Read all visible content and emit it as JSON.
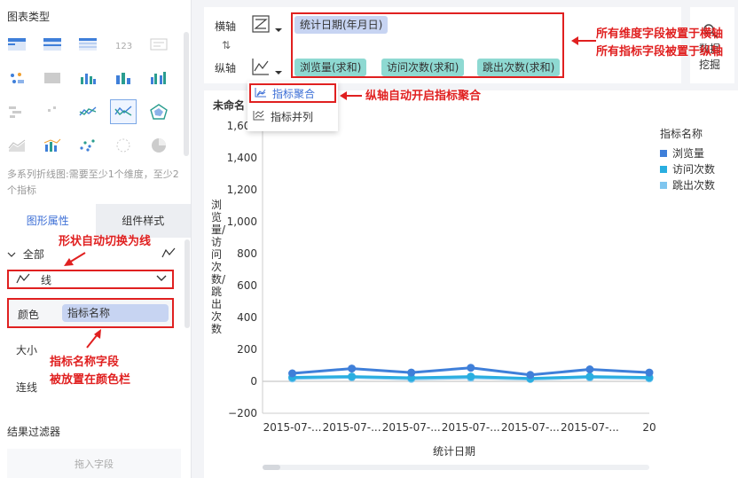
{
  "left_panel": {
    "title": "图表类型",
    "description": "多系列折线图:需要至少1个维度，至少2个指标",
    "chart_types": [
      {
        "icon": "grouped-table-icon"
      },
      {
        "icon": "cross-table-icon"
      },
      {
        "icon": "detail-table-icon"
      },
      {
        "icon": "kpi-card-icon"
      },
      {
        "icon": "text-card-icon"
      },
      {
        "icon": "scatter-map-icon"
      },
      {
        "icon": "heat-map-icon"
      },
      {
        "icon": "stacked-bar-icon"
      },
      {
        "icon": "bar-chart-icon"
      },
      {
        "icon": "grouped-bar-icon"
      },
      {
        "icon": "gantt-icon"
      },
      {
        "icon": "matrix-icon"
      },
      {
        "icon": "line-chart-icon"
      },
      {
        "icon": "multi-line-chart-icon",
        "selected": true
      },
      {
        "icon": "radar-icon"
      },
      {
        "icon": "area-chart-icon"
      },
      {
        "icon": "combo-chart-icon"
      },
      {
        "icon": "scatter-chart-icon"
      },
      {
        "icon": "bubble-chart-icon"
      },
      {
        "icon": "pie-chart-icon"
      }
    ],
    "tabs": [
      {
        "label": "图形属性",
        "active": true
      },
      {
        "label": "组件样式",
        "active": false
      }
    ],
    "all_label": "全部",
    "shape_value": "线",
    "color_label": "颜色",
    "color_field": "指标名称",
    "size_label": "大小",
    "connect_label": "连线",
    "filter_title": "结果过滤器",
    "drop_placeholder": "拖入字段"
  },
  "axis": {
    "x_label": "横轴",
    "y_label": "纵轴",
    "x_fields": [
      "统计日期(年月日)"
    ],
    "y_fields": [
      "浏览量(求和)",
      "访问次数(求和)",
      "跳出次数(求和)"
    ],
    "swap_glyph": "⇅"
  },
  "side_panel": {
    "line1": "数据",
    "line2": "挖掘"
  },
  "popup": {
    "items": [
      "指标聚合",
      "指标并列"
    ]
  },
  "annotations": {
    "top_right_1": "所有维度字段被置于横轴",
    "top_right_2": "所有指标字段被置于纵轴",
    "popup_note": "纵轴自动开启指标聚合",
    "shape_note": "形状自动切换为线",
    "color_note_1": "指标名称字段",
    "color_note_2": "被放置在颜色栏"
  },
  "chart_panel": {
    "name": "未命名"
  },
  "colors": {
    "accent": "#3d6fd6",
    "annotation_red": "#e02020",
    "dim_pill": "#c7d4f2",
    "ind_pill": "#8ed9d2"
  },
  "chart_data": {
    "type": "line",
    "xlabel": "统计日期",
    "ylabel": "浏览量/访问次数/跳出次数",
    "legend_title": "指标名称",
    "ylim": [
      -200,
      1600
    ],
    "yticks": [
      -200,
      0,
      200,
      400,
      600,
      800,
      "1,000",
      "1,200",
      "1,400",
      "1,600"
    ],
    "categories": [
      "2015-07-...",
      "2015-07-...",
      "2015-07-...",
      "2015-07-...",
      "2015-07-...",
      "2015-07-...",
      "20"
    ],
    "series": [
      {
        "name": "浏览量",
        "color": "#3f7fd9",
        "values": [
          50,
          80,
          55,
          85,
          40,
          75,
          55
        ]
      },
      {
        "name": "访问次数",
        "color": "#29aee0",
        "values": [
          25,
          30,
          22,
          30,
          18,
          30,
          24
        ]
      },
      {
        "name": "跳出次数",
        "color": "#7fc6ef",
        "values": [
          18,
          25,
          15,
          22,
          14,
          24,
          18
        ]
      }
    ]
  }
}
